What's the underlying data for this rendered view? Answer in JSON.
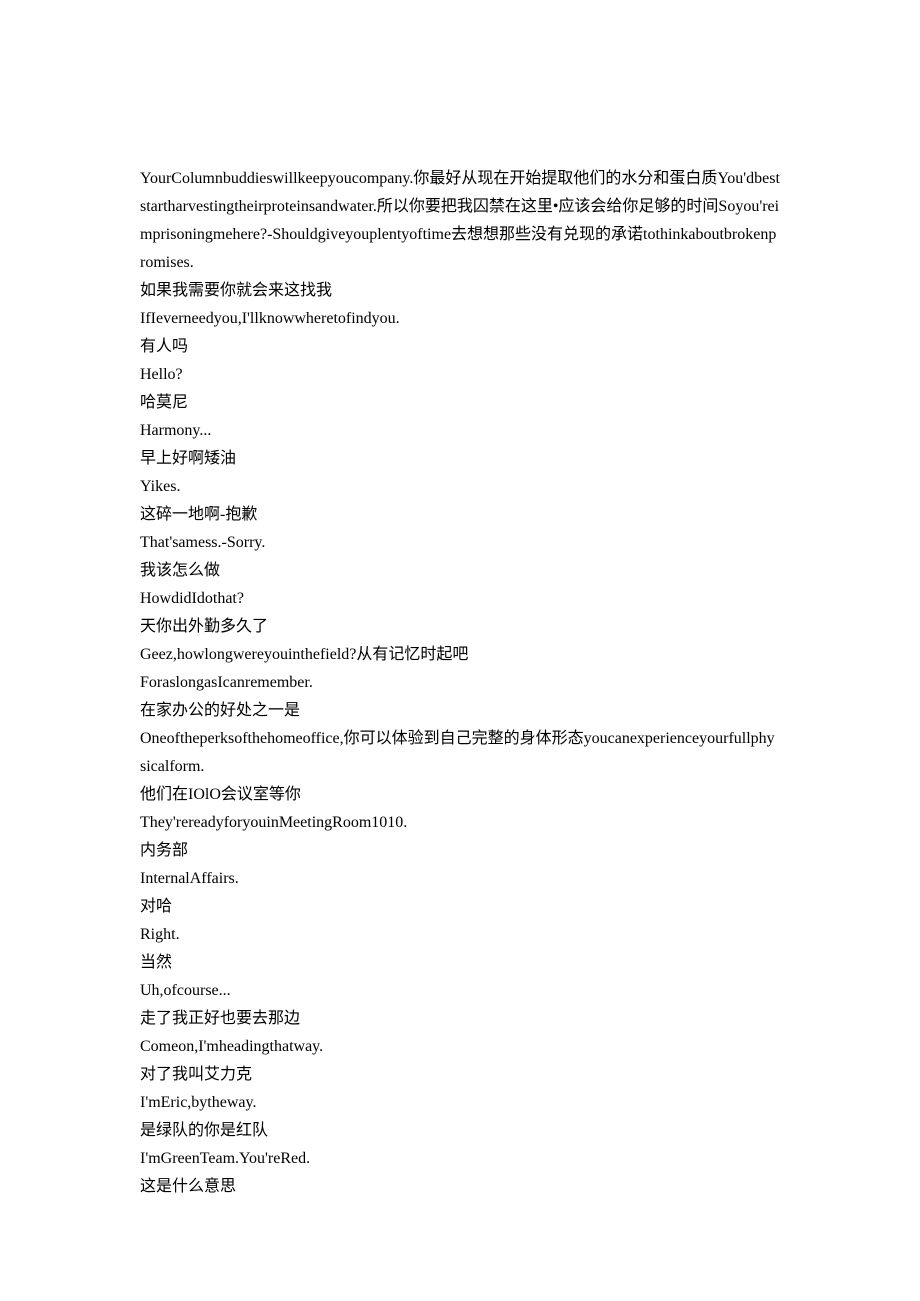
{
  "lines": [
    "YourColumnbuddieswillkeepyoucompany.你最好从现在开始提取他们的水分和蛋白质You'dbeststartharvestingtheirproteinsandwater.所以你要把我囚禁在这里•应该会给你足够的时间Soyou'reimprisoningmehere?-Shouldgiveyouplentyoftime去想想那些没有兑现的承诺tothinkaboutbrokenpromises.",
    "如果我需要你就会来这找我",
    "IfIeverneedyou,I'llknowwheretofindyou.",
    "有人吗",
    "Hello?",
    "哈莫尼",
    "Harmony...",
    "早上好啊矮油",
    "Yikes.",
    "这碎一地啊-抱歉",
    "That'samess.-Sorry.",
    "我该怎么做",
    "HowdidIdothat?",
    "天你出外勤多久了",
    "Geez,howlongwereyouinthefield?从有记忆时起吧",
    "ForaslongasIcanremember.",
    "在家办公的好处之一是",
    "Oneoftheperksofthehomeoffice,你可以体验到自己完整的身体形态youcanexperienceyourfullphysicalform.",
    "他们在IOlO会议室等你",
    "They'rereadyforyouinMeetingRoom1010.",
    "内务部",
    "InternalAffairs.",
    "对哈",
    "Right.",
    "当然",
    "Uh,ofcourse...",
    "走了我正好也要去那边",
    "Comeon,I'mheadingthatway.",
    "对了我叫艾力克",
    "I'mEric,bytheway.",
    "是绿队的你是红队",
    "I'mGreenTeam.You'reRed.",
    "这是什么意思"
  ]
}
